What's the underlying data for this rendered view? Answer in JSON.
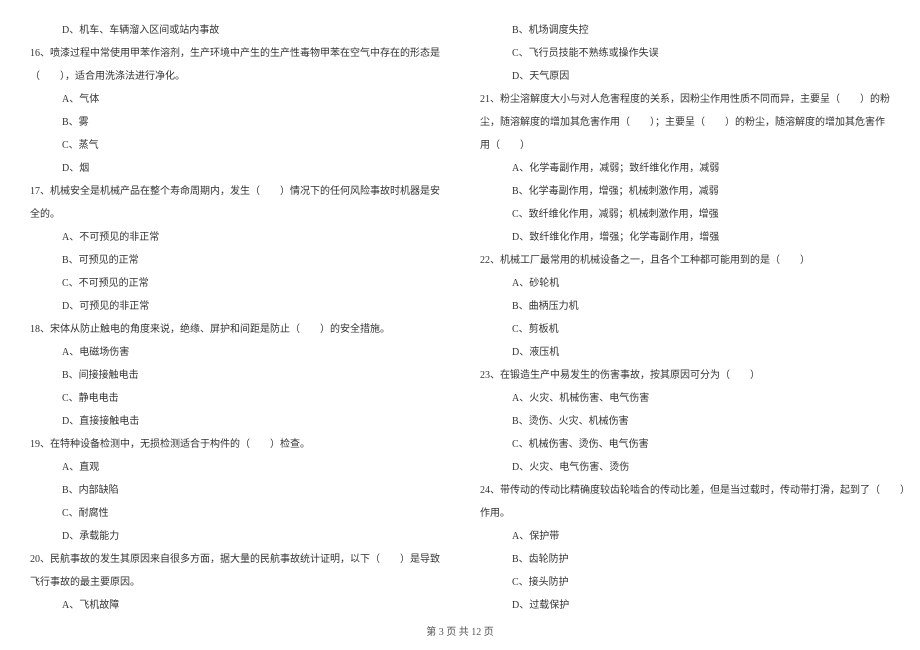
{
  "left": {
    "line_d15": "D、机车、车辆溜入区间或站内事故",
    "q16": "16、喷漆过程中常使用甲苯作溶剂，生产环境中产生的生产性毒物甲苯在空气中存在的形态是",
    "q16_cont": "（　　），适合用洗涤法进行净化。",
    "a16": "A、气体",
    "b16": "B、雾",
    "c16": "C、蒸气",
    "d16": "D、烟",
    "q17": "17、机械安全是机械产品在整个寿命周期内，发生（　　）情况下的任何风险事故时机器是安",
    "q17_cont": "全的。",
    "a17": "A、不可预见的非正常",
    "b17": "B、可预见的正常",
    "c17": "C、不可预见的正常",
    "d17": "D、可预见的非正常",
    "q18": "18、宋体从防止触电的角度来说，绝缘、屏护和间距是防止（　　）的安全措施。",
    "a18": "A、电磁场伤害",
    "b18": "B、间接接触电击",
    "c18": "C、静电电击",
    "d18": "D、直接接触电击",
    "q19": "19、在特种设备检测中，无损检测适合于构件的（　　）检查。",
    "a19": "A、直观",
    "b19": "B、内部缺陷",
    "c19": "C、耐腐性",
    "d19": "D、承载能力",
    "q20": "20、民航事故的发生其原因来自很多方面，据大量的民航事故统计证明，以下（　　）是导致",
    "q20_cont": "飞行事故的最主要原因。",
    "a20": "A、飞机故障"
  },
  "right": {
    "b20": "B、机场调度失控",
    "c20": "C、飞行员技能不熟练或操作失误",
    "d20": "D、天气原因",
    "q21": "21、粉尘溶解度大小与对人危害程度的关系，因粉尘作用性质不同而异，主要呈（　　）的粉",
    "q21_cont": "尘，随溶解度的增加其危害作用（　　）；主要呈（　　）的粉尘，随溶解度的增加其危害作",
    "q21_cont2": "用（　　）",
    "a21": "A、化学毒副作用，减弱；致纤维化作用，减弱",
    "b21": "B、化学毒副作用，增强；机械刺激作用，减弱",
    "c21": "C、致纤维化作用，减弱；机械刺激作用，增强",
    "d21": "D、致纤维化作用，增强；化学毒副作用，增强",
    "q22": "22、机械工厂最常用的机械设备之一，且各个工种都可能用到的是（　　）",
    "a22": "A、砂轮机",
    "b22": "B、曲柄压力机",
    "c22": "C、剪板机",
    "d22": "D、液压机",
    "q23": "23、在锻造生产中易发生的伤害事故，按其原因可分为（　　）",
    "a23": "A、火灾、机械伤害、电气伤害",
    "b23": "B、烫伤、火灾、机械伤害",
    "c23": "C、机械伤害、烫伤、电气伤害",
    "d23": "D、火灾、电气伤害、烫伤",
    "q24": "24、带传动的传动比精确度较齿轮啮合的传动比差，但是当过载时，传动带打滑，起到了（　　）",
    "q24_cont": "作用。",
    "a24": "A、保护带",
    "b24": "B、齿轮防护",
    "c24": "C、接头防护",
    "d24": "D、过载保护"
  },
  "footer": "第 3 页 共 12 页"
}
